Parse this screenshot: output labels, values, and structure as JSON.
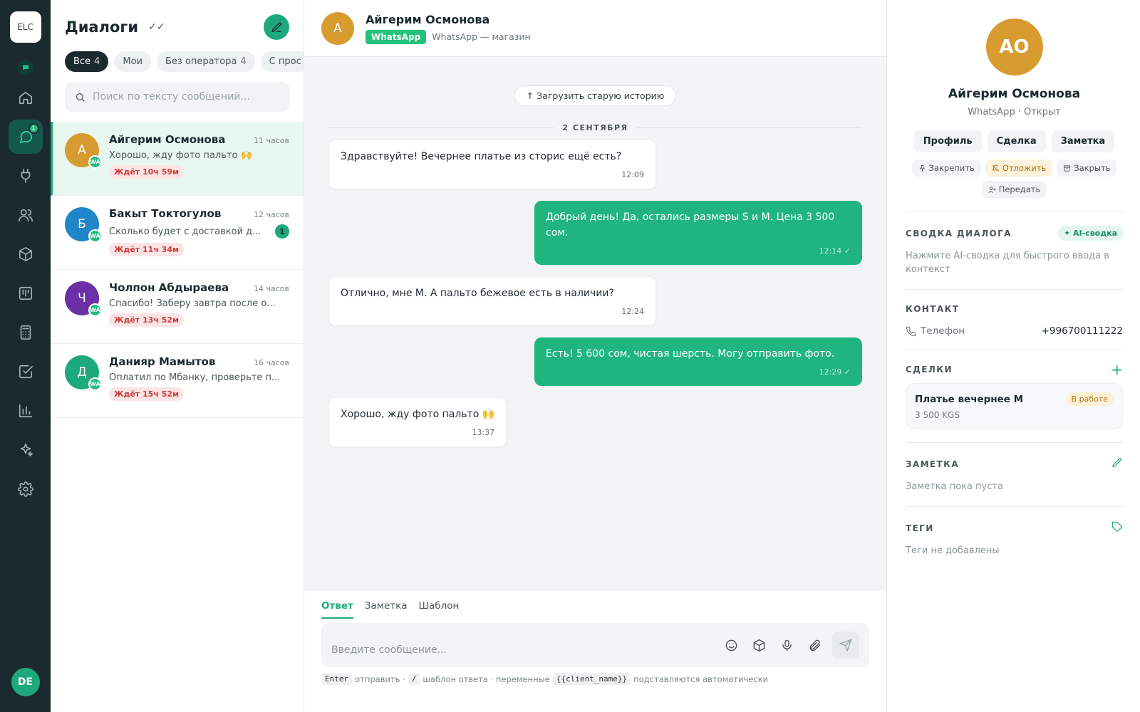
{
  "rail": {
    "logo_text": "ELC",
    "chat_badge": "1",
    "user_initials": "DE"
  },
  "dialogs": {
    "title": "Диалоги",
    "filters": [
      {
        "label": "Все",
        "count": "4"
      },
      {
        "label": "Мои",
        "count": ""
      },
      {
        "label": "Без оператора",
        "count": "4"
      },
      {
        "label": "С прос",
        "count": ""
      }
    ],
    "search_placeholder": "Поиск по тексту сообщений...",
    "items": [
      {
        "initial": "А",
        "name": "Айгерим Осмонова",
        "time": "11 часов",
        "preview": "Хорошо, жду фото пальто 🙌",
        "wait": "Ждёт 10ч 59м",
        "unread": "",
        "color": "#d79b2f"
      },
      {
        "initial": "Б",
        "name": "Бакыт Токтогулов",
        "time": "12 часов",
        "preview": "Сколько будет с доставкой д...",
        "wait": "Ждёт 11ч 34м",
        "unread": "1",
        "color": "#1f86c9"
      },
      {
        "initial": "Ч",
        "name": "Чолпон Абдыраева",
        "time": "14 часов",
        "preview": "Спасибо! Заберу завтра после о...",
        "wait": "Ждёт 13ч 52м",
        "unread": "",
        "color": "#6b2fa6"
      },
      {
        "initial": "Д",
        "name": "Данияр Мамытов",
        "time": "16 часов",
        "preview": "Оплатил по Мбанку, проверьте п...",
        "wait": "Ждёт 15ч 52м",
        "unread": "",
        "color": "#1ea97c"
      }
    ],
    "wa_mark": "WA"
  },
  "chat": {
    "initial": "А",
    "name": "Айгерим Осмонова",
    "channel": "WhatsApp",
    "source": "WhatsApp — магазин",
    "load_history": "↑ Загрузить старую историю",
    "date": "2 СЕНТЯБРЯ",
    "messages": [
      {
        "dir": "in",
        "text": "Здравствуйте! Вечернее платье из сторис ещё есть?",
        "time": "12:09"
      },
      {
        "dir": "out",
        "text": "Добрый день! Да, остались размеры S и M. Цена 3 500 сом.",
        "time": "12:14 ✓"
      },
      {
        "dir": "in",
        "text": "Отлично, мне M. А пальто бежевое есть в наличии?",
        "time": "12:24"
      },
      {
        "dir": "out",
        "text": "Есть! 5 600 сом, чистая шерсть. Могу отправить фото.",
        "time": "12:29 ✓"
      },
      {
        "dir": "in",
        "text": "Хорошо, жду фото пальто 🙌",
        "time": "13:37"
      }
    ],
    "composer": {
      "tabs": [
        "Ответ",
        "Заметка",
        "Шаблон"
      ],
      "placeholder": "Введите сообщение...",
      "hint_enter": "Enter",
      "hint_send": "отправить ·",
      "hint_slash": "/",
      "hint_template": "шаблон ответа · переменные",
      "hint_var": "{{client_name}}",
      "hint_auto": "подставляются автоматически"
    }
  },
  "profile": {
    "initials": "АО",
    "name": "Айгерим Осмонова",
    "sub": "WhatsApp · Открыт",
    "buttons": [
      "Профиль",
      "Сделка",
      "Заметка"
    ],
    "actions": {
      "pin": "Закрепить",
      "snooze": "Отложить",
      "close": "Закрыть",
      "transfer": "Передать"
    },
    "summary": {
      "title": "СВОДКА ДИАЛОГА",
      "ai_label": "✦ AI-сводка",
      "text": "Нажмите AI-сводка для быстрого ввода в контекст"
    },
    "contact": {
      "title": "КОНТАКТ",
      "phone_label": "Телефон",
      "phone_value": "+996700111222"
    },
    "deals": {
      "title": "СДЕЛКИ",
      "add": "+",
      "items": [
        {
          "name": "Платье вечернее M",
          "status": "В работе",
          "amount": "3 500 KGS"
        }
      ]
    },
    "note": {
      "title": "ЗАМЕТКА",
      "text": "Заметка пока пуста"
    },
    "tags": {
      "title": "ТЕГИ",
      "text": "Теги не добавлены"
    }
  }
}
